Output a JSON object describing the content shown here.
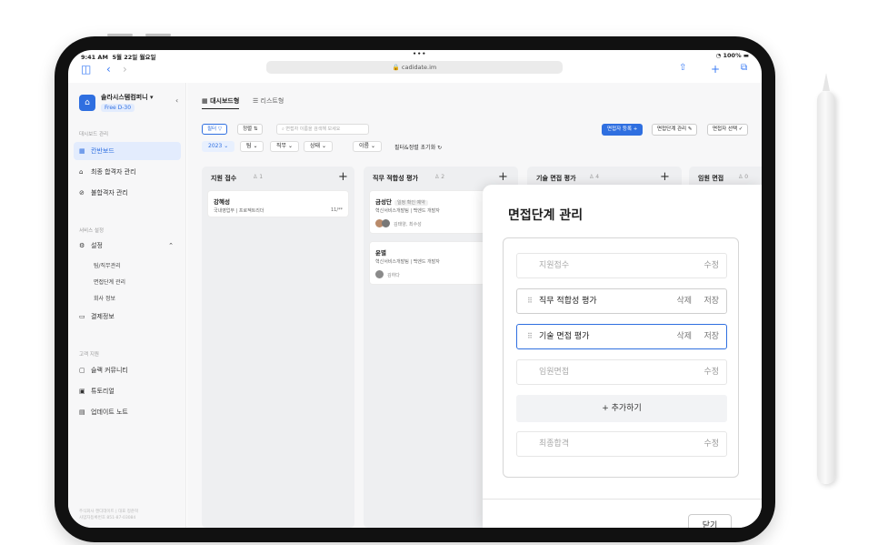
{
  "status": {
    "time": "9:41 AM",
    "date": "5월 22일 월요일",
    "battery": "100%"
  },
  "browser": {
    "url": "cadidate.im",
    "icons": [
      "sidebar-icon",
      "back-icon",
      "forward-icon",
      "share-icon",
      "plus-icon",
      "tabs-icon"
    ]
  },
  "sidebar": {
    "company": "솔라시스템컴퍼니 ▾",
    "plan": "Free D-30",
    "sections": [
      {
        "title": "대시보드 관리",
        "items": [
          {
            "label": "칸반보드",
            "icon": "▦"
          },
          {
            "label": "최종 합격자 관리",
            "icon": "⌂"
          },
          {
            "label": "불합격자 관리",
            "icon": "⊘"
          }
        ]
      },
      {
        "title": "서비스 설정",
        "items": [
          {
            "label": "설정",
            "icon": "⚙",
            "sub": [
              "팀/직무관리",
              "면접단계 관리",
              "회사 정보"
            ]
          },
          {
            "label": "결제정보",
            "icon": "▭"
          }
        ]
      },
      {
        "title": "고객 지원",
        "items": [
          {
            "label": "슬랙 커뮤니티",
            "icon": "▢"
          },
          {
            "label": "튜토리얼",
            "icon": "▣"
          },
          {
            "label": "업데이트 노트",
            "icon": "▤"
          }
        ]
      }
    ],
    "footer": [
      "주식회사 캔디데이트 | 대표 정준혁",
      "사업자등록번호 851-87-03084"
    ]
  },
  "main": {
    "views": [
      "대시보드형",
      "리스트형"
    ],
    "filter": "필터",
    "sort": "정렬",
    "search_placeholder": "면접자 이름을 검색해 보세요",
    "dropdowns": [
      "2023",
      "팀",
      "직무",
      "상태",
      "이름"
    ],
    "reset": "필터&정렬 초기화",
    "actions": {
      "add": "면접자 등록 +",
      "stage": "면접단계 관리",
      "select": "면접자 선택"
    },
    "columns": [
      {
        "name": "지원 접수",
        "count": "1",
        "cards": [
          {
            "name": "강혜성",
            "sub": "국내영업부 | 프로젝트리더",
            "date": "11/**"
          }
        ]
      },
      {
        "name": "직무 적합성 평가",
        "count": "2",
        "cards": [
          {
            "name": "금성단",
            "tag": "일정 확인 예약",
            "sub": "혁신서비스개발팀 | 백엔드 개발자",
            "who": "김태양, 최수성"
          },
          {
            "name": "윤별",
            "sub": "혁신서비스개발팀 | 백엔드 개발자",
            "who": "김하다"
          }
        ]
      },
      {
        "name": "기술 면접 평가",
        "count": "4",
        "cards": []
      },
      {
        "name": "임원 면접",
        "count": "0",
        "cards": []
      }
    ]
  },
  "panel": {
    "title": "면접단계 관리",
    "stages": [
      {
        "label": "지원접수",
        "action": "수정",
        "state": "dim"
      },
      {
        "label": "직무 적합성 평가",
        "delete": "삭제",
        "action": "저장",
        "state": "active"
      },
      {
        "label": "기술 면접 평가",
        "delete": "삭제",
        "action": "저장",
        "state": "focus"
      },
      {
        "label": "임원면접",
        "action": "수정",
        "state": "dim"
      },
      {
        "label": "최종합격",
        "action": "수정",
        "state": "dim"
      }
    ],
    "add_label": "+ 추가하기",
    "close_label": "닫기"
  },
  "colors": {
    "accent": "#2f6fe0"
  }
}
